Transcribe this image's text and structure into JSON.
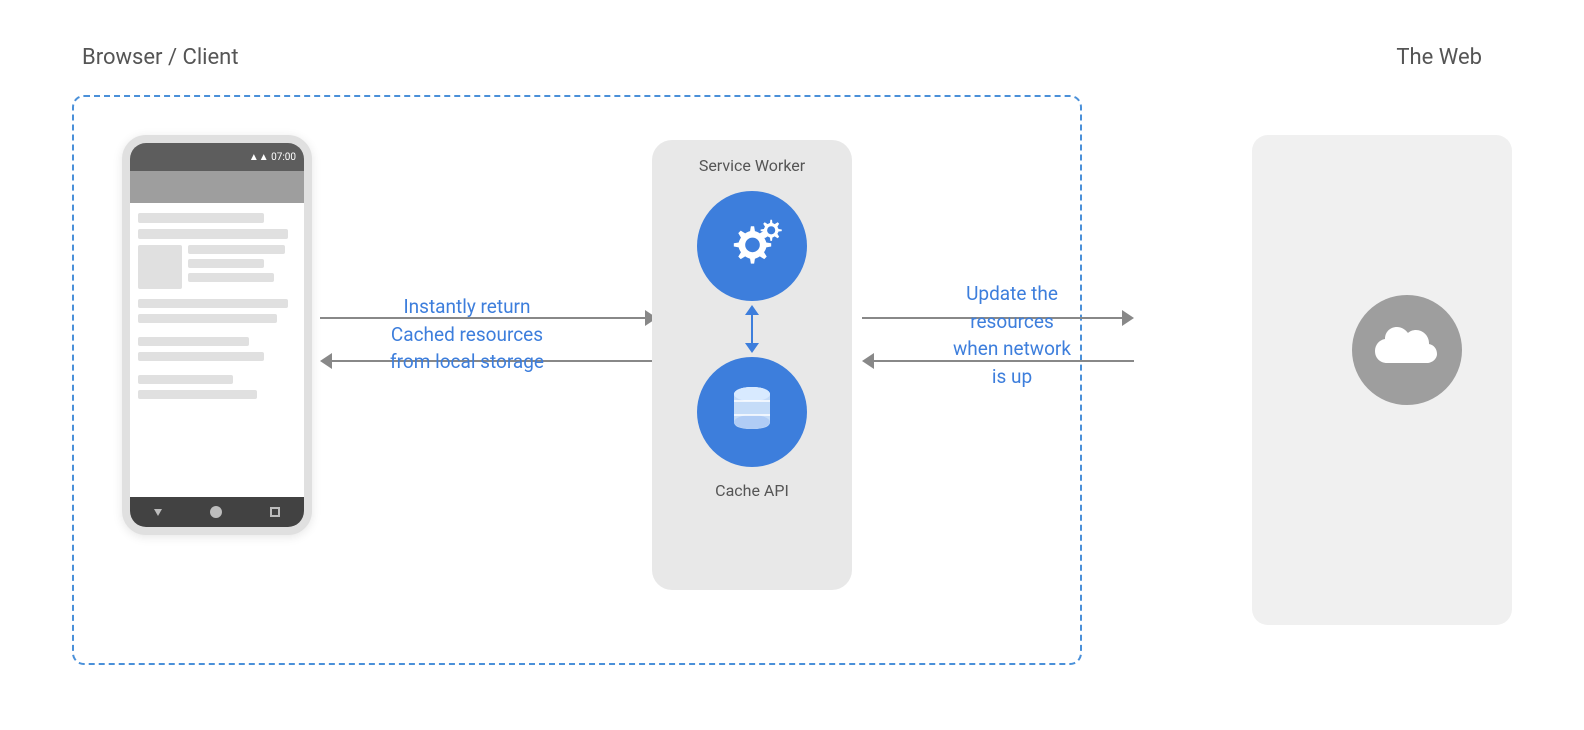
{
  "labels": {
    "browser_client": "Browser / Client",
    "the_web": "The Web",
    "service_worker": "Service Worker",
    "cache_api": "Cache API",
    "instantly_return": "Instantly return",
    "cached_resources": "Cached resources",
    "from_local_storage": "from local storage",
    "update_the": "Update the",
    "resources": "resources",
    "when_network": "when network",
    "is_up": "is up"
  },
  "colors": {
    "blue": "#3d7edc",
    "gray_box": "#e8e8e8",
    "arrow_gray": "#888888",
    "text_gray": "#555555",
    "dashed_border": "#4a90d9"
  }
}
